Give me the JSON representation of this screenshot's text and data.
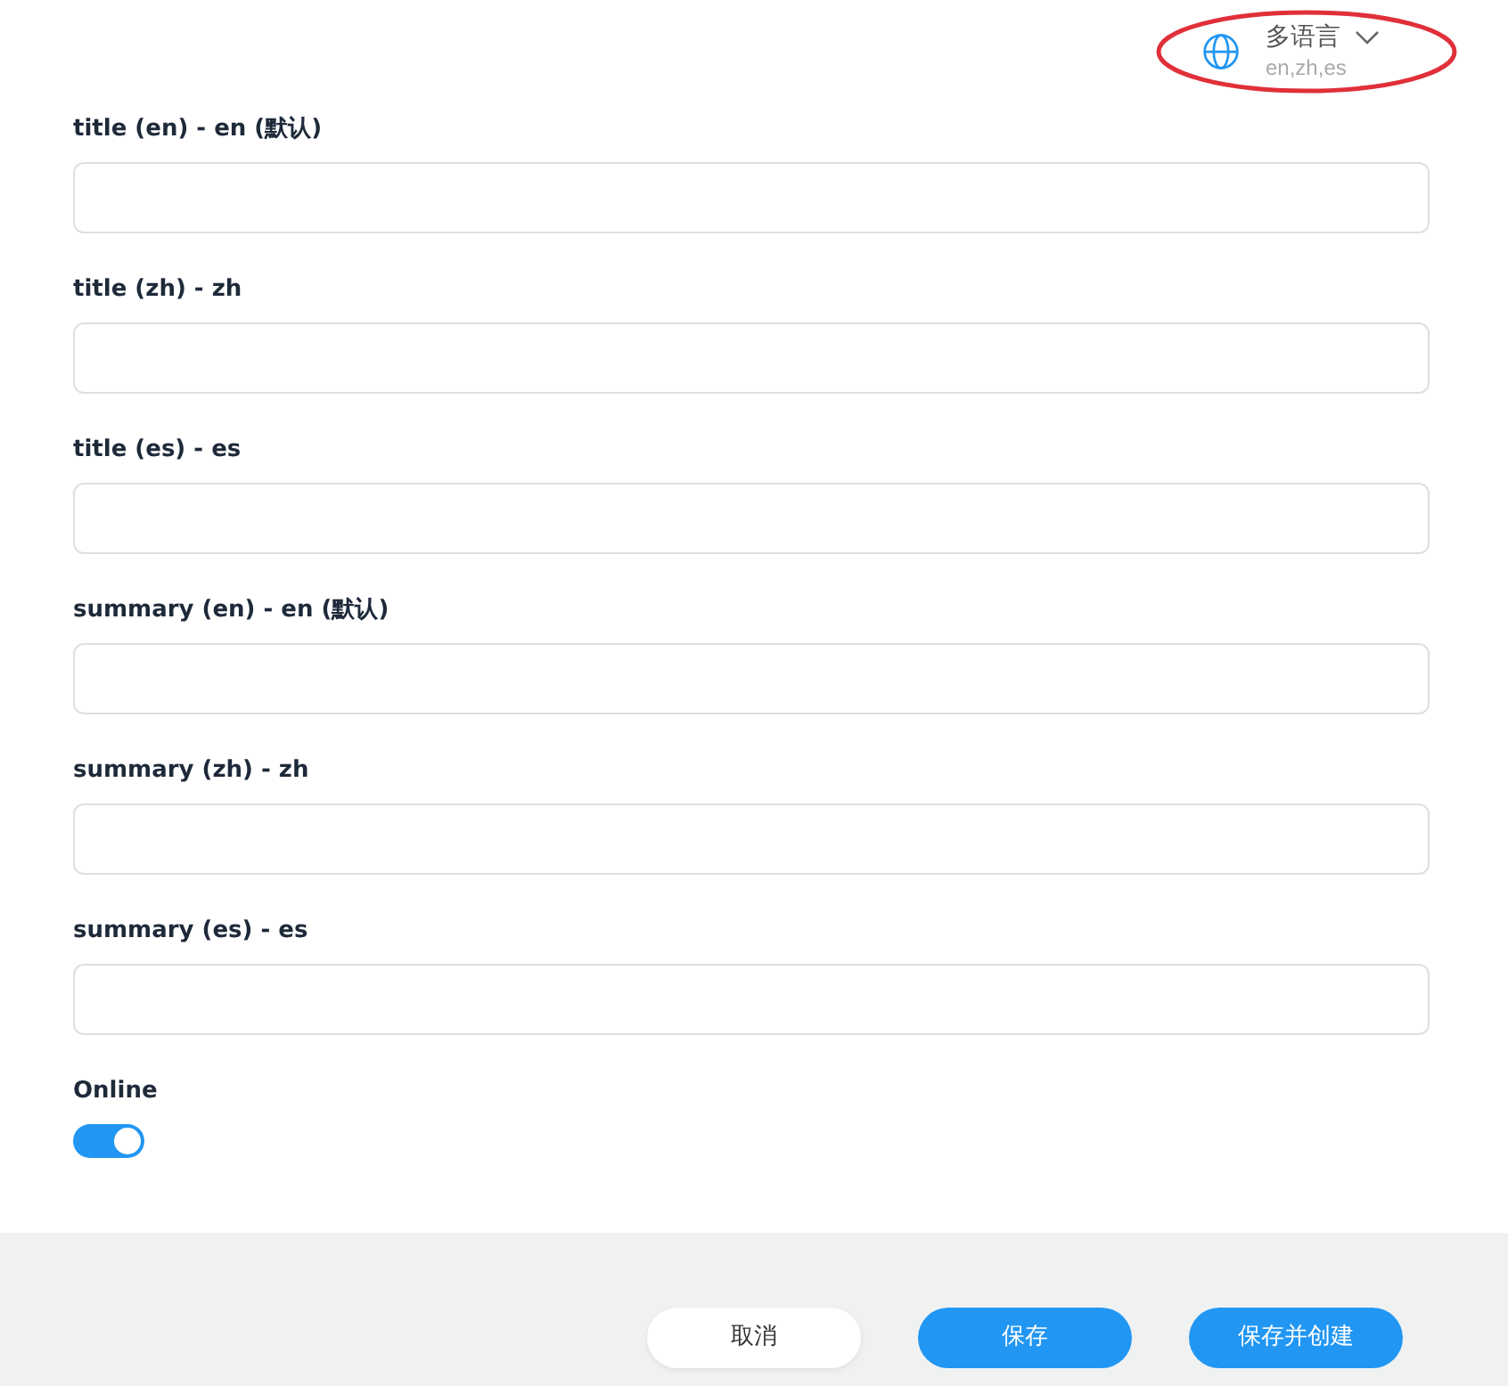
{
  "language_selector": {
    "label": "多语言",
    "languages": "en,zh,es",
    "highlighted": true
  },
  "fields": [
    {
      "label": "title (en) - en (默认)"
    },
    {
      "label": "title (zh) - zh"
    },
    {
      "label": "title (es) - es"
    },
    {
      "label": "summary (en) - en (默认)"
    },
    {
      "label": "summary (zh) - zh"
    },
    {
      "label": "summary (es) - es"
    }
  ],
  "online": {
    "label": "Online",
    "on": true
  },
  "buttons": [
    {
      "label": "取消",
      "kind": "secondary"
    },
    {
      "label": "保存",
      "kind": "primary"
    },
    {
      "label": "保存并创建",
      "kind": "primary"
    }
  ]
}
